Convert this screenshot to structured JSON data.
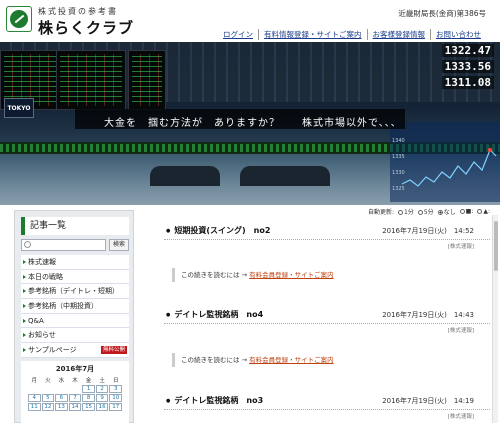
{
  "header": {
    "site_sub": "株式投資の参考書",
    "site_title": "株らくクラブ",
    "registration": "近畿財局長(金商)第386号",
    "nav": [
      "ログイン",
      "有料情報登録・サイトご案内",
      "お客様登録情報",
      "お問い合わせ"
    ]
  },
  "hero": {
    "exchange_sign": "TOKYO",
    "prices": [
      "1322.47",
      "1333.56",
      "1311.08"
    ],
    "chart_ticks": [
      "1340",
      "1335",
      "1330",
      "1325"
    ],
    "text_left": "大金を　掴む方法が　ありますか？",
    "text_right": "株式市場以外で、、、"
  },
  "sidebar": {
    "heading": "記事一覧",
    "search_button": "検索",
    "menu": [
      {
        "label": "株式速報"
      },
      {
        "label": "本日の戦略"
      },
      {
        "label": "参考銘柄（デイトレ・短期）"
      },
      {
        "label": "参考銘柄（中期投資）"
      },
      {
        "label": "Q&A"
      },
      {
        "label": "お知らせ"
      },
      {
        "label": "サンプルページ",
        "badge": "無料公開"
      }
    ],
    "calendar": {
      "title": "2016年7月",
      "weekdays": [
        "月",
        "火",
        "水",
        "木",
        "金",
        "土",
        "日"
      ],
      "weeks": [
        [
          "",
          "",
          "",
          "",
          "1",
          "2",
          "3"
        ],
        [
          "4",
          "5",
          "6",
          "7",
          "8",
          "9",
          "10"
        ],
        [
          "11",
          "12",
          "13",
          "14",
          "15",
          "16",
          "17"
        ]
      ]
    }
  },
  "main": {
    "auto_refresh_label": "自動更新:",
    "refresh_options": [
      "1分",
      "5分",
      "なし"
    ],
    "view_options": [
      "■:",
      "▲:"
    ],
    "posts": [
      {
        "title": "短期投資(スイング)　no2",
        "date": "2016年7月19日(火)　14:52",
        "category": "[株式速報]",
        "more_text": "この続きを読むには → ",
        "more_link": "有料会員登録・サイトご案内"
      },
      {
        "title": "デイトレ監視銘柄　no4",
        "date": "2016年7月19日(火)　14:43",
        "category": "[株式速報]",
        "more_text": "この続きを読むには → ",
        "more_link": "有料会員登録・サイトご案内"
      },
      {
        "title": "デイトレ監視銘柄　no3",
        "date": "2016年7月19日(火)　14:19",
        "category": "[株式速報]"
      }
    ]
  }
}
